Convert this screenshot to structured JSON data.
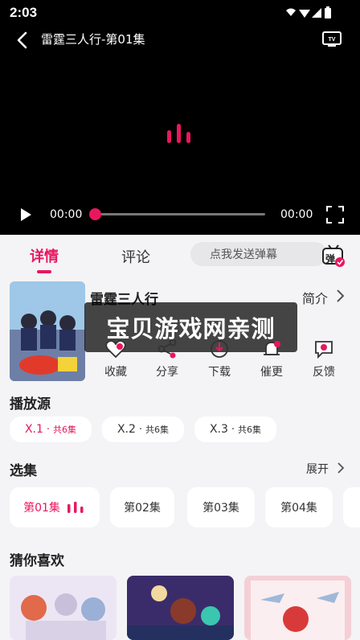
{
  "status": {
    "time": "2:03"
  },
  "player": {
    "title": "雷霆三人行-第01集",
    "current_time": "00:00",
    "total_time": "00:00",
    "progress": 0,
    "tv_icon": "tv-cast-icon"
  },
  "tabs": {
    "details": "详情",
    "comments": "评论"
  },
  "danmaku": {
    "placeholder": "点我发送弹幕",
    "badge": "弹"
  },
  "show": {
    "title": "雷霆三人行",
    "intro_label": "简介",
    "watermark": "宝贝游戏网亲测"
  },
  "actions": [
    {
      "label": "收藏",
      "icon": "heart-icon"
    },
    {
      "label": "分享",
      "icon": "share-icon"
    },
    {
      "label": "下载",
      "icon": "download-icon"
    },
    {
      "label": "催更",
      "icon": "bell-icon"
    },
    {
      "label": "反馈",
      "icon": "feedback-icon"
    }
  ],
  "sources": {
    "heading": "播放源",
    "items": [
      {
        "name": "X.1",
        "count": "共6集"
      },
      {
        "name": "X.2",
        "count": "共6集"
      },
      {
        "name": "X.3",
        "count": "共6集"
      }
    ]
  },
  "episodes": {
    "heading": "选集",
    "expand": "展开",
    "items": [
      "第01集",
      "第02集",
      "第03集",
      "第04集"
    ]
  },
  "recommend": {
    "heading": "猜你喜欢"
  },
  "colors": {
    "accent": "#e8175d",
    "background": "#f4f4f6"
  }
}
